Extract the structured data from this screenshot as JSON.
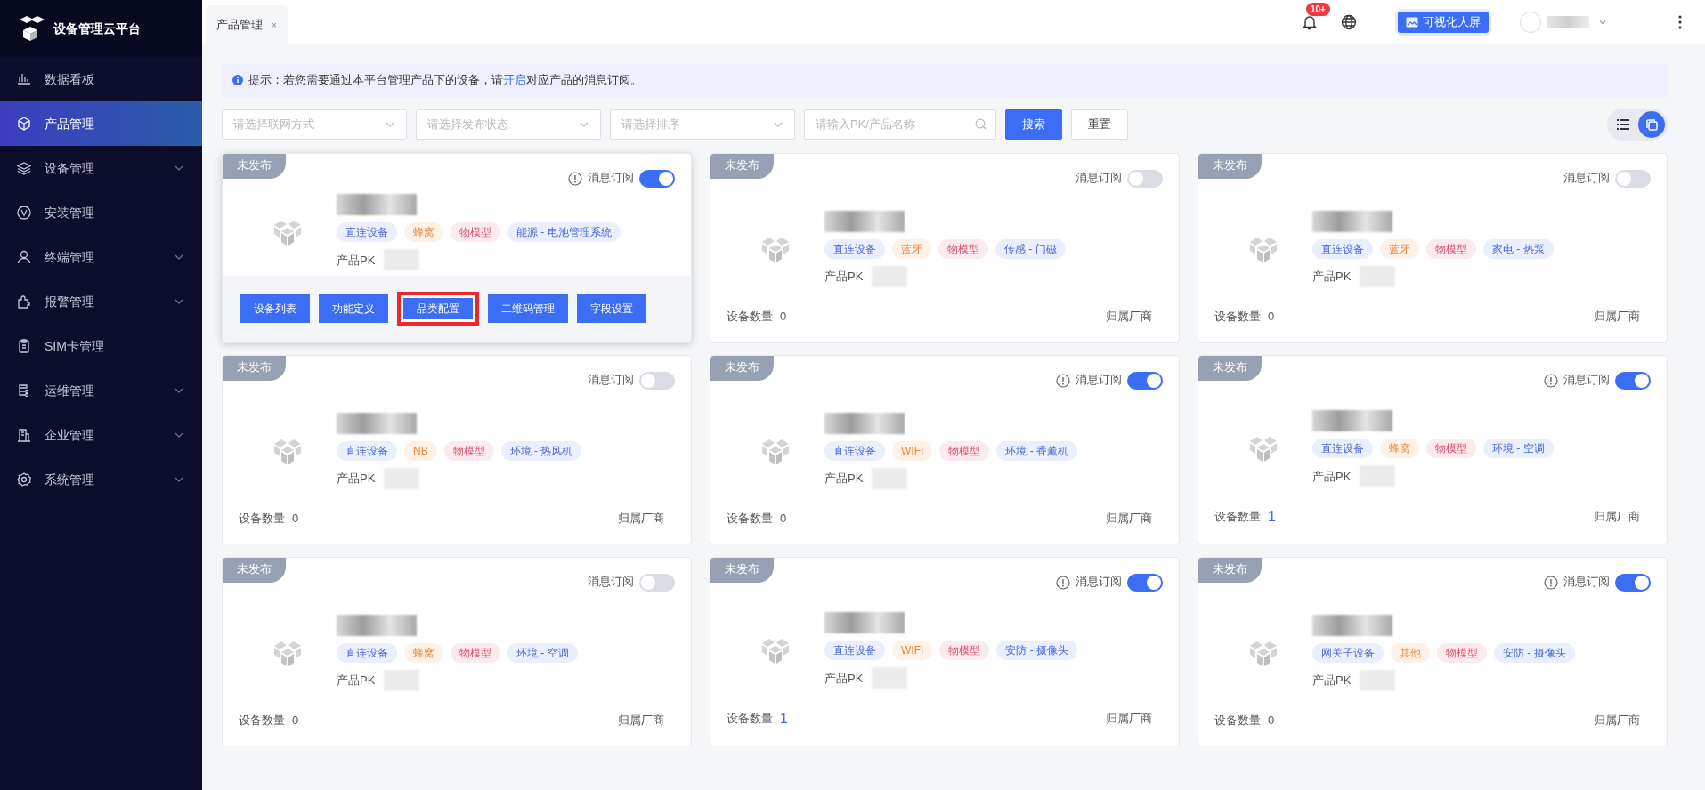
{
  "sidebar": {
    "title": "设备管理云平台",
    "items": [
      {
        "label": "数据看板",
        "selected": false,
        "expandable": false
      },
      {
        "label": "产品管理",
        "selected": true,
        "expandable": false
      },
      {
        "label": "设备管理",
        "selected": false,
        "expandable": true
      },
      {
        "label": "安装管理",
        "selected": false,
        "expandable": false
      },
      {
        "label": "终端管理",
        "selected": false,
        "expandable": true
      },
      {
        "label": "报警管理",
        "selected": false,
        "expandable": true
      },
      {
        "label": "SIM卡管理",
        "selected": false,
        "expandable": false
      },
      {
        "label": "运维管理",
        "selected": false,
        "expandable": true
      },
      {
        "label": "企业管理",
        "selected": false,
        "expandable": true
      },
      {
        "label": "系统管理",
        "selected": false,
        "expandable": true
      }
    ]
  },
  "topbar": {
    "tabs": [
      {
        "label": "产品管理",
        "selected": true,
        "close": "×"
      }
    ],
    "notification_badge": "10+",
    "visual_button": "可视化大屏"
  },
  "notice": {
    "text": "提示：若您需要通过本平台管理产品下的设备，请",
    "link": "开启",
    "text_after": "对应产品的消息订阅。"
  },
  "filters": {
    "selects": [
      {
        "placeholder": "请选择联网方式"
      },
      {
        "placeholder": "请选择发布状态"
      },
      {
        "placeholder": "请选择排序"
      }
    ],
    "search": {
      "placeholder": "请输入PK/产品名称"
    },
    "buttons": [
      {
        "label": "搜索",
        "kind": "primary"
      },
      {
        "label": "重置",
        "kind": "default"
      }
    ]
  },
  "view_toggle": [
    {
      "selected": false
    },
    {
      "selected": true
    }
  ],
  "products": [
    {
      "status": "未发布",
      "subscription_label": "消息订阅",
      "subscribed": true,
      "tags": [
        {
          "label": "直连设备",
          "kind": "access"
        },
        {
          "label": "蜂窝",
          "kind": "network"
        },
        {
          "label": "物模型",
          "kind": "model"
        },
        {
          "label": "能源 - 电池管理系统",
          "kind": "category"
        }
      ],
      "pk_label": "产品PK",
      "actions": [
        {
          "label": "设备列表",
          "highlighted": false
        },
        {
          "label": "功能定义",
          "highlighted": false
        },
        {
          "label": "品类配置",
          "highlighted": true
        },
        {
          "label": "二维码管理",
          "highlighted": false
        },
        {
          "label": "字段设置",
          "highlighted": false
        }
      ]
    },
    {
      "status": "未发布",
      "subscription_label": "消息订阅",
      "subscribed": false,
      "tags": [
        {
          "label": "直连设备",
          "kind": "access"
        },
        {
          "label": "蓝牙",
          "kind": "network"
        },
        {
          "label": "物模型",
          "kind": "model"
        },
        {
          "label": "传感 - 门磁",
          "kind": "category"
        }
      ],
      "pk_label": "产品PK",
      "device_count_label": "设备数量",
      "device_count": "0",
      "count_emphasized": false,
      "vendor_label": "归属厂商"
    },
    {
      "status": "未发布",
      "subscription_label": "消息订阅",
      "subscribed": false,
      "tags": [
        {
          "label": "直连设备",
          "kind": "access"
        },
        {
          "label": "蓝牙",
          "kind": "network"
        },
        {
          "label": "物模型",
          "kind": "model"
        },
        {
          "label": "家电 - 热泵",
          "kind": "category"
        }
      ],
      "pk_label": "产品PK",
      "device_count_label": "设备数量",
      "device_count": "0",
      "count_emphasized": false,
      "vendor_label": "归属厂商"
    },
    {
      "status": "未发布",
      "subscription_label": "消息订阅",
      "subscribed": false,
      "tags": [
        {
          "label": "直连设备",
          "kind": "access"
        },
        {
          "label": "NB",
          "kind": "network"
        },
        {
          "label": "物模型",
          "kind": "model"
        },
        {
          "label": "环境 - 热风机",
          "kind": "category"
        }
      ],
      "pk_label": "产品PK",
      "device_count_label": "设备数量",
      "device_count": "0",
      "count_emphasized": false,
      "vendor_label": "归属厂商"
    },
    {
      "status": "未发布",
      "subscription_label": "消息订阅",
      "subscribed": true,
      "tags": [
        {
          "label": "直连设备",
          "kind": "access"
        },
        {
          "label": "WIFI",
          "kind": "network"
        },
        {
          "label": "物模型",
          "kind": "model"
        },
        {
          "label": "环境 - 香薰机",
          "kind": "category"
        }
      ],
      "pk_label": "产品PK",
      "device_count_label": "设备数量",
      "device_count": "0",
      "count_emphasized": false,
      "vendor_label": "归属厂商"
    },
    {
      "status": "未发布",
      "subscription_label": "消息订阅",
      "subscribed": true,
      "tags": [
        {
          "label": "直连设备",
          "kind": "access"
        },
        {
          "label": "蜂窝",
          "kind": "network"
        },
        {
          "label": "物模型",
          "kind": "model"
        },
        {
          "label": "环境 - 空调",
          "kind": "category"
        }
      ],
      "pk_label": "产品PK",
      "device_count_label": "设备数量",
      "device_count": "1",
      "count_emphasized": true,
      "vendor_label": "归属厂商"
    },
    {
      "status": "未发布",
      "subscription_label": "消息订阅",
      "subscribed": false,
      "tags": [
        {
          "label": "直连设备",
          "kind": "access"
        },
        {
          "label": "蜂窝",
          "kind": "network"
        },
        {
          "label": "物模型",
          "kind": "model"
        },
        {
          "label": "环境 - 空调",
          "kind": "category"
        }
      ],
      "pk_label": "产品PK",
      "device_count_label": "设备数量",
      "device_count": "0",
      "count_emphasized": false,
      "vendor_label": "归属厂商"
    },
    {
      "status": "未发布",
      "subscription_label": "消息订阅",
      "subscribed": true,
      "tags": [
        {
          "label": "直连设备",
          "kind": "access"
        },
        {
          "label": "WIFI",
          "kind": "network"
        },
        {
          "label": "物模型",
          "kind": "model"
        },
        {
          "label": "安防 - 摄像头",
          "kind": "category"
        }
      ],
      "pk_label": "产品PK",
      "device_count_label": "设备数量",
      "device_count": "1",
      "count_emphasized": true,
      "vendor_label": "归属厂商"
    },
    {
      "status": "未发布",
      "subscription_label": "消息订阅",
      "subscribed": true,
      "tags": [
        {
          "label": "网关子设备",
          "kind": "access"
        },
        {
          "label": "其他",
          "kind": "network"
        },
        {
          "label": "物模型",
          "kind": "model"
        },
        {
          "label": "安防 - 摄像头",
          "kind": "category"
        }
      ],
      "pk_label": "产品PK",
      "device_count_label": "设备数量",
      "device_count": "0",
      "count_emphasized": false,
      "vendor_label": "归属厂商"
    }
  ]
}
